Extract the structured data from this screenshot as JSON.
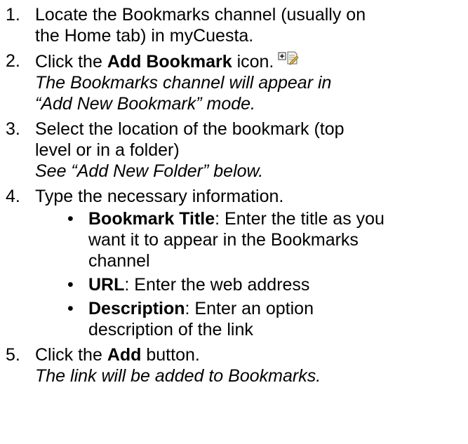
{
  "steps": [
    {
      "num": "1.",
      "line1": "Locate the Bookmarks channel (usually on",
      "line2": "the Home tab) in myCuesta."
    },
    {
      "num": "2.",
      "pre": "Click the ",
      "bold": "Add Bookmark",
      "post": " icon.",
      "icon": "add-bookmark-icon",
      "note1": "The Bookmarks channel will appear in",
      "note2": "“Add New Bookmark” mode."
    },
    {
      "num": "3.",
      "line1": "Select the location of the bookmark (top",
      "line2": "level or in a folder)",
      "note1": "See “Add New Folder” below."
    },
    {
      "num": "4.",
      "line1": "Type the necessary information.",
      "subitems": [
        {
          "bold": "Bookmark Title",
          "line1": ": Enter the title as you",
          "line2": "want it to appear in the Bookmarks",
          "line3": "channel"
        },
        {
          "bold": "URL",
          "line1": ": Enter the web address"
        },
        {
          "bold": "Description",
          "line1": ": Enter an option",
          "line2": "description of the link"
        }
      ]
    },
    {
      "num": "5.",
      "pre": "Click the ",
      "bold": "Add",
      "post": " button.",
      "note1": "The link will be added to Bookmarks."
    }
  ],
  "bullet_char": "•"
}
